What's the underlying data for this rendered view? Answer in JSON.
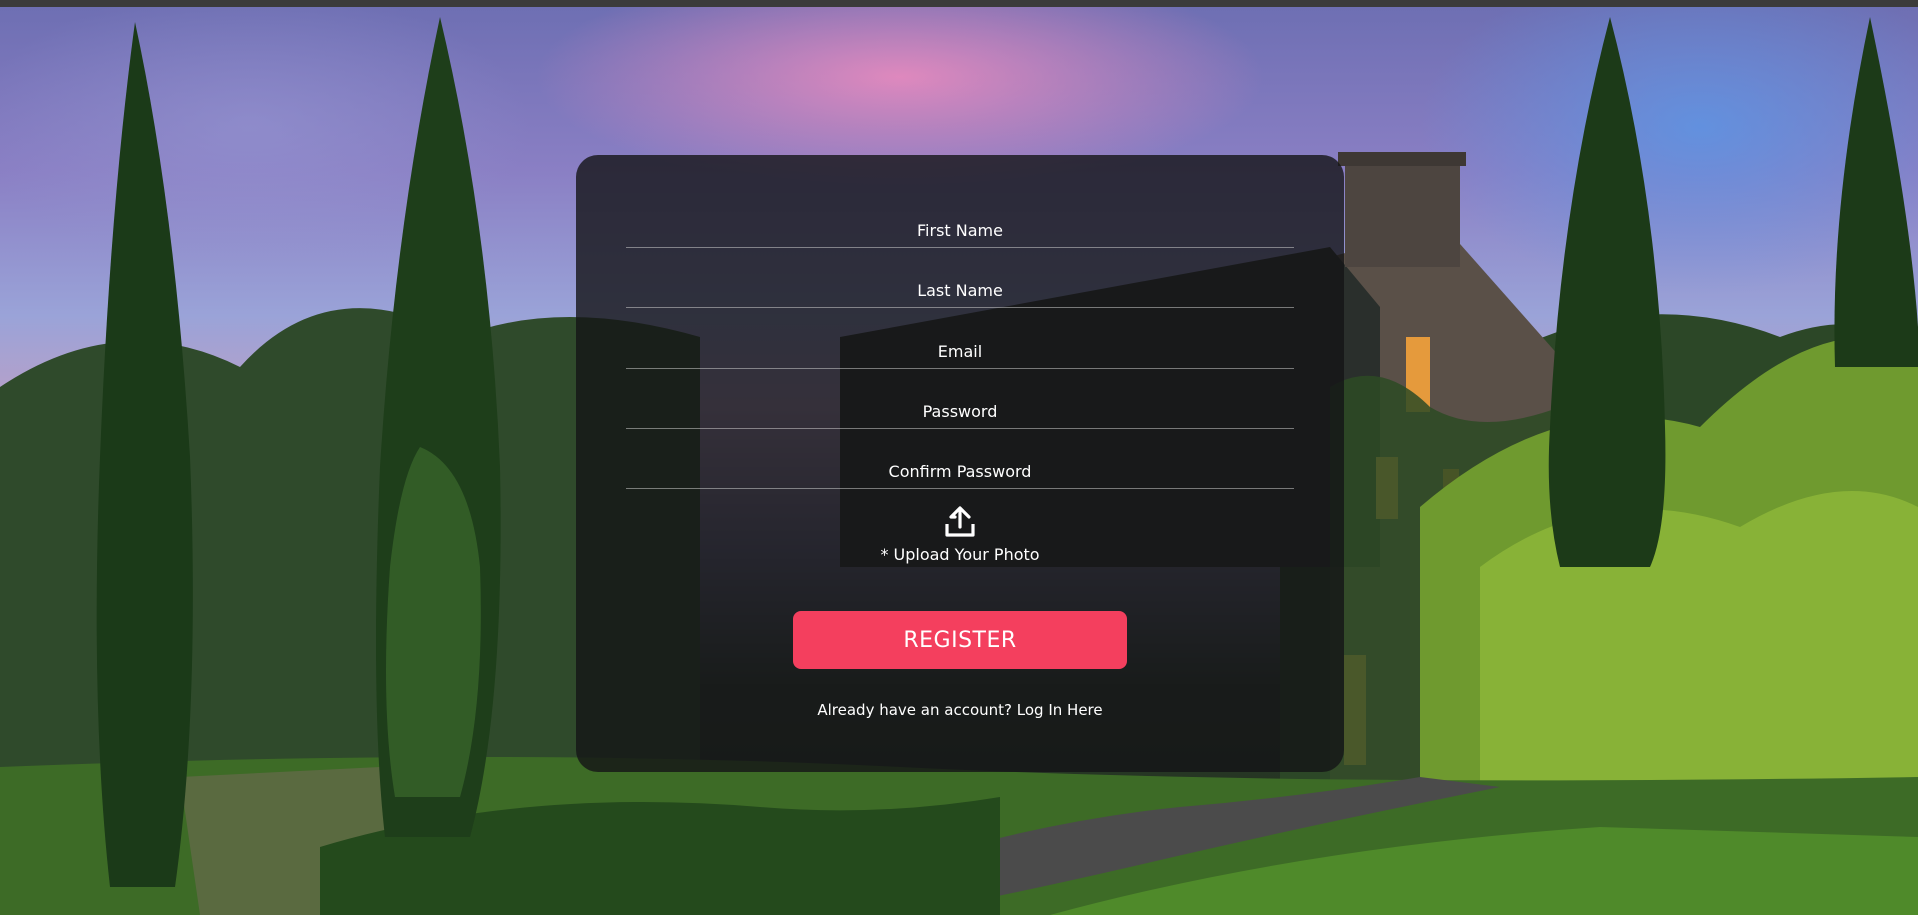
{
  "form": {
    "first_name_placeholder": "First Name",
    "last_name_placeholder": "Last Name",
    "email_placeholder": "Email",
    "password_placeholder": "Password",
    "confirm_password_placeholder": "Confirm Password",
    "upload_icon": "upload-icon",
    "upload_label": "* Upload Your Photo",
    "register_label": "REGISTER",
    "login_prompt": "Already have an account?",
    "login_link": "Log In Here"
  },
  "colors": {
    "register_button": "#f43f5e",
    "card_background": "rgba(20,20,22,0.80)",
    "text": "#ffffff"
  }
}
